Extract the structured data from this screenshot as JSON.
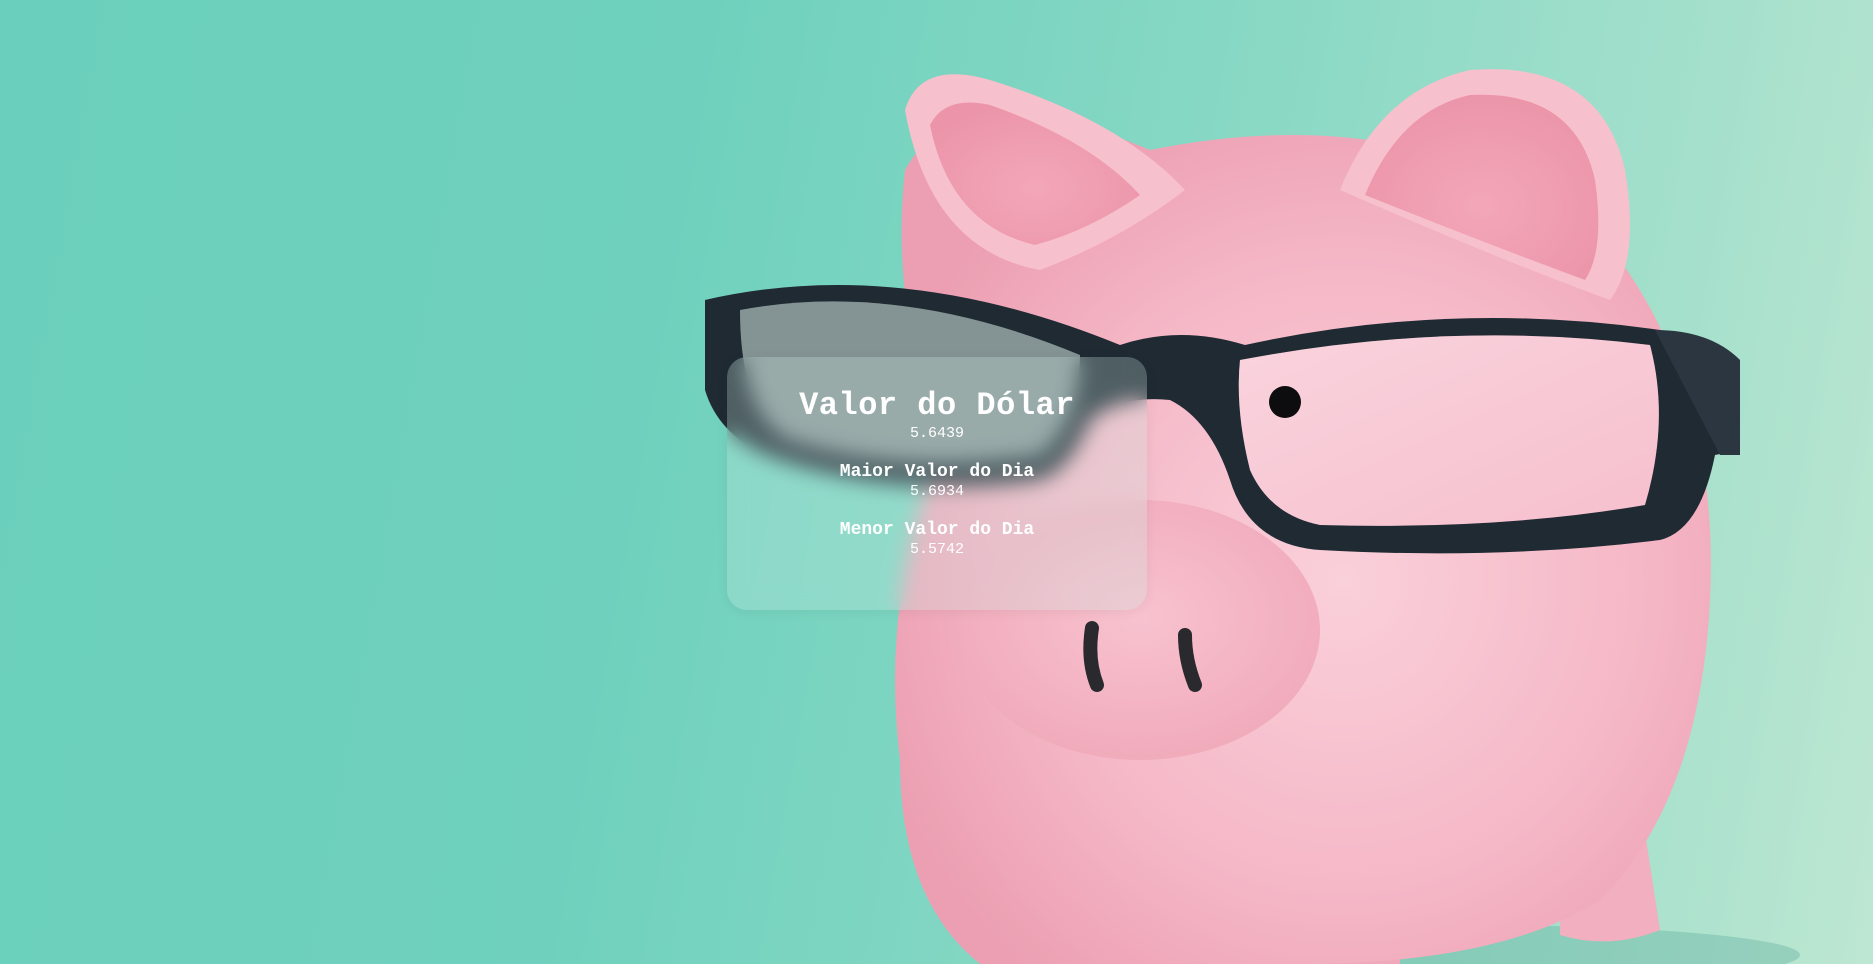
{
  "card": {
    "title": "Valor do Dólar",
    "current_value": "5.6439",
    "high_label": "Maior Valor do Dia",
    "high_value": "5.6934",
    "low_label": "Menor Valor do Dia",
    "low_value": "5.5742"
  },
  "background": {
    "image_subject": "piggy-bank-with-glasses",
    "bg_color": "#6fd1bd",
    "pig_color": "#f6bccb",
    "glasses_color": "#1f2a33"
  }
}
